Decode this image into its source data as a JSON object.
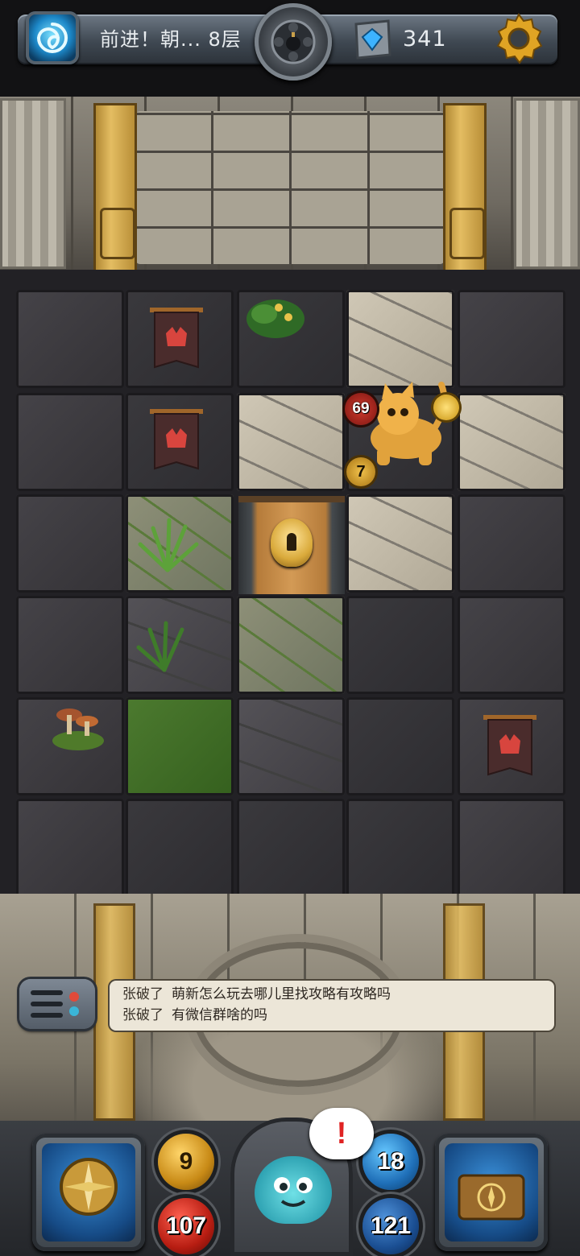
{
  "header": {
    "floor_title": "前进！朝... 8层",
    "coins": "341",
    "icons": {
      "portal": "swirl-portal-icon",
      "center": "bomb-medal-icon",
      "currency": "blue-gem-icon",
      "settings": "gear-icon"
    }
  },
  "board": {
    "hero": {
      "hp": "69",
      "attack": "7"
    },
    "door": "locked-door-icon",
    "banners": [
      "fox-banner-icon",
      "fox-banner-icon",
      "fox-banner-icon"
    ]
  },
  "chat": {
    "messages": [
      {
        "user": "张破了",
        "text": "萌新怎么玩去哪儿里找攻略有攻略吗"
      },
      {
        "user": "张破了",
        "text": "有微信群啥的吗"
      }
    ]
  },
  "hud": {
    "attack": "9",
    "hp": "107",
    "defense": "18",
    "mp": "121",
    "alert": "!"
  },
  "colors": {
    "hp_red": "#b71d12",
    "attack_gold": "#c88a16",
    "defense_blue": "#1f6fb8",
    "accent_gold": "#e4bd62"
  }
}
